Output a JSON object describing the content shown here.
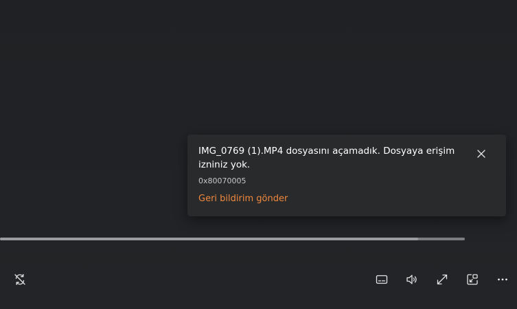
{
  "error_toast": {
    "message": "IMG_0769 (1).MP4 dosyasını açamadık. Dosyaya erişim izniniz yok.",
    "error_code": "0x80070005",
    "feedback_link": "Geri bildirim gönder"
  },
  "seek_bar": {
    "progress": 0.9
  },
  "controls": {
    "left": [
      "repeat-off-icon"
    ],
    "right": [
      "subtitles-icon",
      "volume-icon",
      "fullscreen-icon",
      "mini-player-icon",
      "more-options-icon"
    ]
  },
  "colors": {
    "background": "#202225",
    "toast_background": "#282a2c",
    "accent_link": "#f0883e"
  }
}
